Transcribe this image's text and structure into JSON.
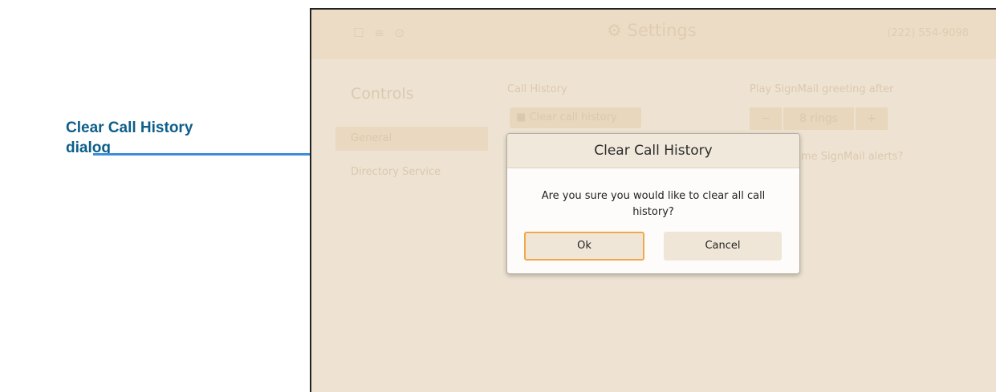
{
  "callout": {
    "line1": "Clear Call History",
    "line2": "dialog"
  },
  "topbar": {
    "status_icons": "☐ ≡ ⊙",
    "gear_icon": "⚙",
    "title": "Settings",
    "phone": "(222) 554-9098"
  },
  "sidebar": {
    "title": "Controls",
    "items": [
      {
        "label": "General"
      },
      {
        "label": "Directory Service"
      }
    ]
  },
  "call_history": {
    "label": "Call History",
    "trash_icon": "■",
    "button_label": "Clear call history"
  },
  "signmail": {
    "greeting_label": "Play SignMail greeting after",
    "minus": "−",
    "rings_value": "8 rings",
    "plus": "+",
    "alerts_label_partial": "me SignMail alerts?"
  },
  "dialog": {
    "title": "Clear Call History",
    "message": "Are you sure you would like to clear all call history?",
    "ok_label": "Ok",
    "cancel_label": "Cancel"
  },
  "colors": {
    "callout_text": "#0d5e8a",
    "arrow": "#3b8ed8",
    "ok_focus_border": "#efa94a",
    "screen_bg": "#eee3d2"
  }
}
